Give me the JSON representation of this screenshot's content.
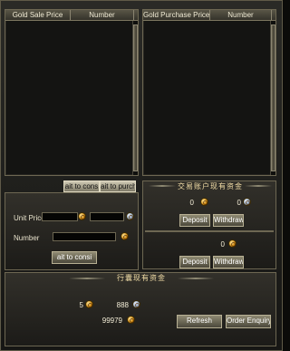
{
  "sale_list": {
    "col_price": "Gold Sale Price",
    "col_number": "Number"
  },
  "purchase_list": {
    "col_price": "Gold Purchase Price",
    "col_number": "Number"
  },
  "tabs": {
    "tab1": "ait to cons",
    "tab2": "ait to purch"
  },
  "order_form": {
    "unit_price_label": "Unit Price",
    "number_label": "Number",
    "submit_label": "ait to consi"
  },
  "account": {
    "title": "交易账户现有资金",
    "gold": "0",
    "silver": "0",
    "deposit1": "Deposit",
    "withdraw1": "Withdraw",
    "gold2": "0",
    "deposit2": "Deposit",
    "withdraw2": "Withdraw"
  },
  "market": {
    "title": "行囊现有资金",
    "val1": "5",
    "val2": "888",
    "val3": "99979",
    "refresh": "Refresh",
    "order_enquiry": "Order Enquiry"
  }
}
